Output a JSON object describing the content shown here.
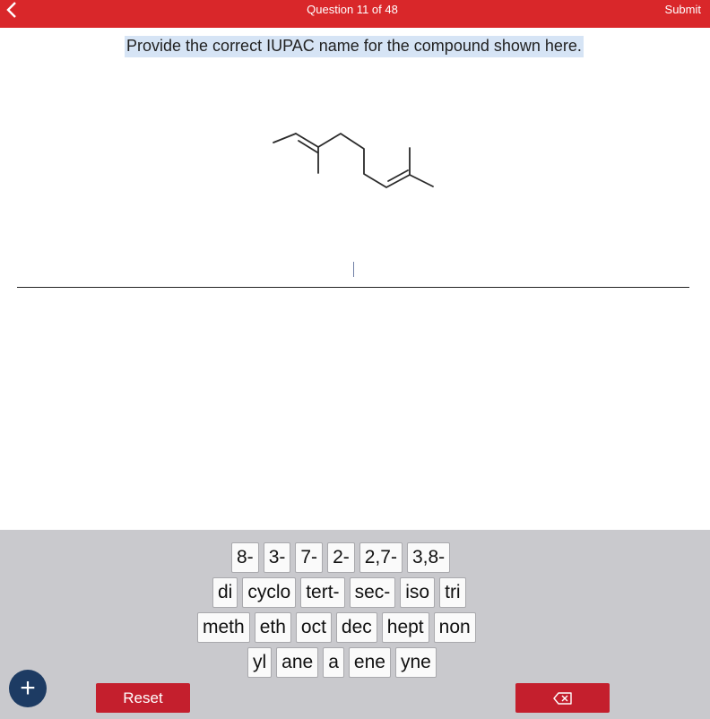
{
  "header": {
    "title": "Question 11 of 48",
    "submit_label": "Submit",
    "back_icon": "chevron-left-icon"
  },
  "question": {
    "prompt": "Provide the correct IUPAC name for the compound shown here."
  },
  "keyboard": {
    "rows": [
      [
        "8-",
        "3-",
        "7-",
        "2-",
        "2,7-",
        "3,8-"
      ],
      [
        "di",
        "cyclo",
        "tert-",
        "sec-",
        "iso",
        "tri"
      ],
      [
        "meth",
        "eth",
        "oct",
        "dec",
        "hept",
        "non"
      ],
      [
        "yl",
        "ane",
        "a",
        "ene",
        "yne"
      ]
    ]
  },
  "actions": {
    "reset_label": "Reset",
    "add_icon": "plus-icon",
    "delete_icon": "backspace-icon"
  },
  "colors": {
    "header_bg": "#d9272a",
    "button_red": "#c41f2d",
    "add_button": "#1d3b63",
    "keyboard_bg": "#c9c9cd",
    "highlight": "#d6e4f5"
  }
}
